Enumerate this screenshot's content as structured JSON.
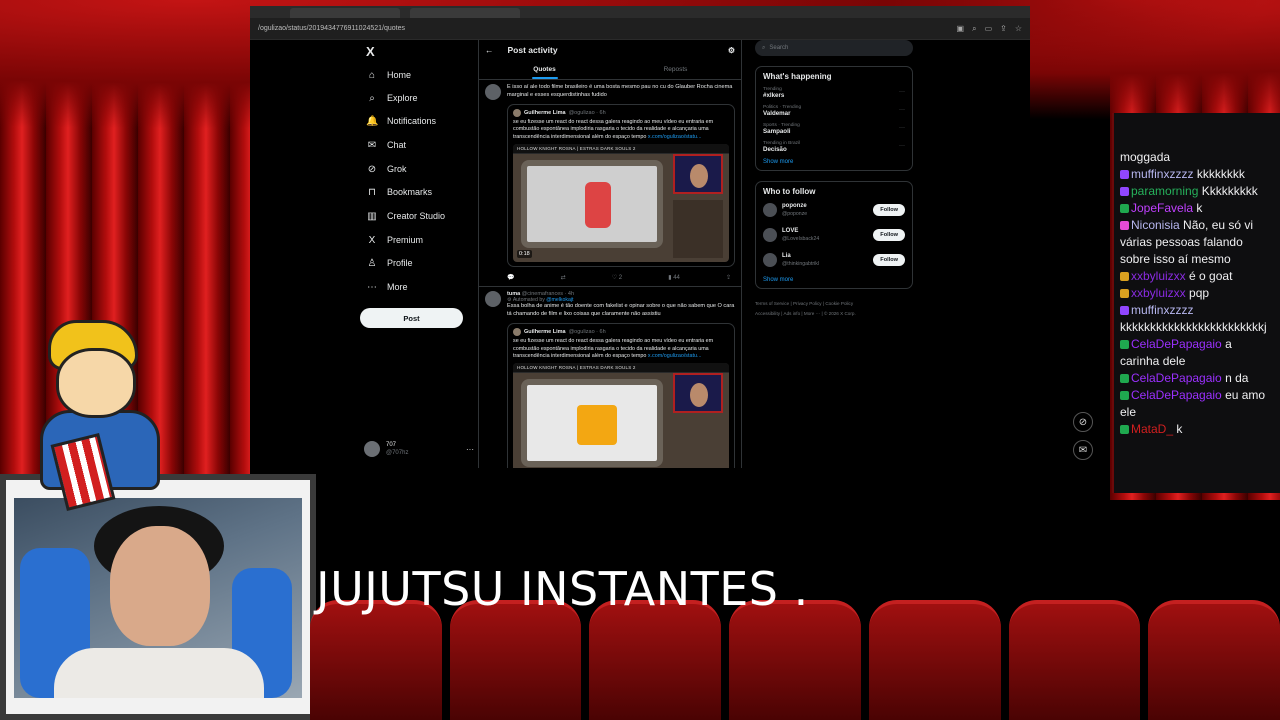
{
  "browser": {
    "url": "/ogulizao/status/2019434776911024521/quotes"
  },
  "nav": {
    "logo": "X",
    "items": [
      {
        "label": "Home",
        "icon": "⌂"
      },
      {
        "label": "Explore",
        "icon": "⌕"
      },
      {
        "label": "Notifications",
        "icon": "🔔"
      },
      {
        "label": "Chat",
        "icon": "✉"
      },
      {
        "label": "Grok",
        "icon": "⊘"
      },
      {
        "label": "Bookmarks",
        "icon": "⊓"
      },
      {
        "label": "Creator Studio",
        "icon": "▥"
      },
      {
        "label": "Premium",
        "icon": "X"
      },
      {
        "label": "Profile",
        "icon": "♙"
      },
      {
        "label": "More",
        "icon": "⋯"
      }
    ],
    "post_button": "Post",
    "account": {
      "name": "707",
      "handle": "@707hz",
      "more": "···"
    }
  },
  "center": {
    "back": "←",
    "title": "Post activity",
    "tabs": [
      {
        "label": "Quotes"
      },
      {
        "label": "Reposts"
      }
    ],
    "post1": {
      "text": "E isso aí ale todo filme brasileiro é uma bosta mesmo pau no cu do Glauber Rocha cinema marginal e esses esquerdistinhas fudido",
      "quote": {
        "author": "Guilherme Lima",
        "handle": "@ogulizao · 6h",
        "text": "se eu fizesse um react do react dessa galera reagindo ao meu vídeo eu entraria em combustão espontânea implodiria rasgaria o tecido da realidade e alcançaria uma transcendência interdimensional além do espaço tempo ",
        "link": "x.com/ogulizao/statu...",
        "media_title": "HOLLOW KNIGHT ROSNA | ESTRAS DARK SOULS 2",
        "duration": "0:18"
      },
      "actions": {
        "reply": "",
        "repost": "",
        "like": "2",
        "views": "44"
      }
    },
    "post2": {
      "name": "tuma",
      "handle": "@cinemafrances · 4h",
      "automated": "Automated by",
      "automated_by": "@melkokajt",
      "text": "Essa bolha de anime é tão doente com fakelist e opinar sobre o que não sabem que O cara tá chamando de film e lixo coisas que claramente não assistiu",
      "quote": {
        "author": "Guilherme Lima",
        "handle": "@ogulizao · 6h",
        "text": "se eu fizesse um react do react dessa galera reagindo ao meu vídeo eu entraria em combustão espontânea implodiria rasgaria o tecido da realidade e alcançaria uma transcendência interdimensional além do espaço tempo ",
        "link": "x.com/ogulizao/statu...",
        "media_title": "HOLLOW KNIGHT ROSNA | ESTRAS DARK SOULS 2"
      }
    }
  },
  "right": {
    "search_placeholder": "Search",
    "happening": {
      "title": "What's happening",
      "trends": [
        {
          "meta": "Trending",
          "name": "#xlkers"
        },
        {
          "meta": "Politics · Trending",
          "name": "Valdemar"
        },
        {
          "meta": "Sports · Trending",
          "name": "Sampaoli"
        },
        {
          "meta": "Trending in Brazil",
          "name": "Decisão"
        }
      ],
      "show_more": "Show more"
    },
    "follow": {
      "title": "Who to follow",
      "accounts": [
        {
          "name": "poponze",
          "handle": "@poponze",
          "button": "Follow"
        },
        {
          "name": "LOVE",
          "handle": "@LoveIsback24",
          "button": "Follow"
        },
        {
          "name": "Lia",
          "handle": "@thinkingabtrikl",
          "button": "Follow"
        }
      ],
      "show_more": "Show more"
    },
    "footer": [
      "Terms of Service",
      "Privacy Policy",
      "Cookie Policy",
      "Accessibility",
      "Ads info",
      "More ···",
      "© 2026 X Corp."
    ]
  },
  "chat": {
    "messages": [
      {
        "user": "",
        "text": "moggada",
        "color": "#efeff1"
      },
      {
        "user": "muffinxzzzz",
        "text": "kkkkkkkk",
        "color": "#b7b7f0"
      },
      {
        "user": "paramorning",
        "text": "Kkkkkkkkk",
        "color": "#26b15b"
      },
      {
        "user": "JopeFavela",
        "text": "k",
        "color": "#c040ff"
      },
      {
        "user": "Niconisia",
        "text": "Não, eu só vi várias pessoas falando sobre isso aí mesmo",
        "color": "#b7b7f0"
      },
      {
        "user": "xxbyluizxx",
        "text": "é o goat",
        "color": "#8a2be2"
      },
      {
        "user": "xxbyluizxx",
        "text": "pqp",
        "color": "#8a2be2"
      },
      {
        "user": "muffinxzzzz",
        "text": "kkkkkkkkkkkkkkkkkkkkkkkkj",
        "color": "#b7b7f0"
      },
      {
        "user": "CelaDePapagaio",
        "text": "a carinha dele",
        "color": "#9b30ff"
      },
      {
        "user": "CelaDePapagaio",
        "text": "n da",
        "color": "#9b30ff"
      },
      {
        "user": "CelaDePapagaio",
        "text": "eu amo ele",
        "color": "#9b30ff"
      },
      {
        "user": "MataD_",
        "text": "k",
        "color": "#d21f1f"
      }
    ]
  },
  "overlay": {
    "caption": "JUJUTSU INSTANTES ."
  }
}
